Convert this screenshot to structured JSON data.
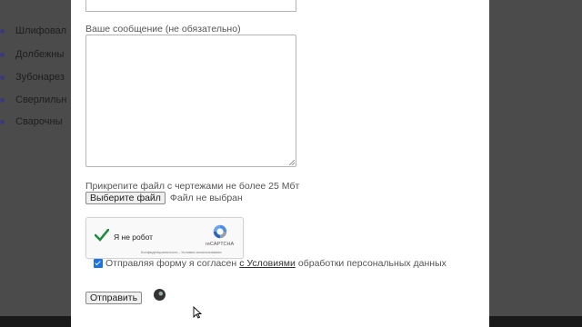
{
  "background_menu": {
    "items": [
      {
        "label": "Шлифовал"
      },
      {
        "label": "Долбежны"
      },
      {
        "label": "Зубонарез"
      },
      {
        "label": "Сверлильн"
      },
      {
        "label": "Сварочны"
      }
    ]
  },
  "form": {
    "message_label": "Ваше сообщение (не обязательно)",
    "message_value": "",
    "file_label": "Прикрепите файл с чертежами не более 25 Мбт",
    "file_button": "Выберите файл",
    "file_status": "Файл не выбран",
    "consent_before": "Отправляя форму я согласен",
    "consent_link": "с Условиями",
    "consent_after": "обработки персональных данных",
    "consent_checked": true,
    "submit_label": "Отправить"
  },
  "recaptcha": {
    "label": "Я не робот",
    "brand": "reCAPTCHA",
    "links": "Конфиденциальность - Условия использования",
    "checked": true
  },
  "colors": {
    "overlay": "#4b4b4b",
    "checkmark": "#1e8e3e",
    "accent": "#1a73e8"
  }
}
